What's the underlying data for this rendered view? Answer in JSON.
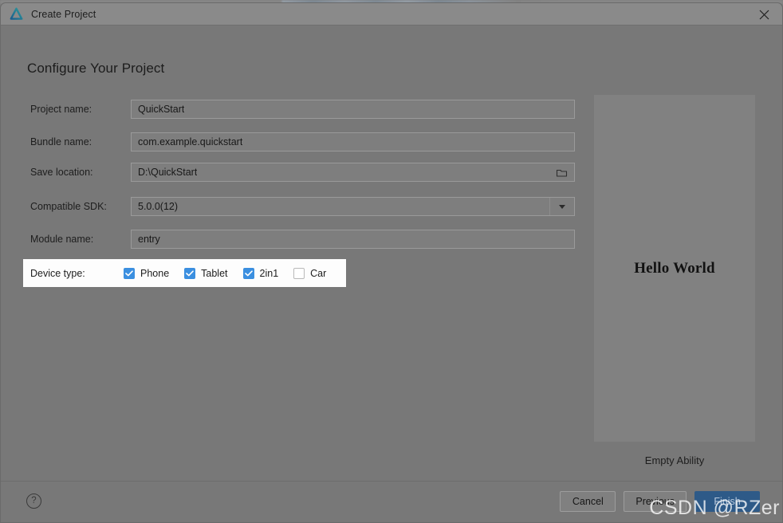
{
  "window": {
    "title": "Create Project",
    "logo_icon": "deveco-triangle-logo",
    "close_icon": "close-icon"
  },
  "page": {
    "heading": "Configure Your Project"
  },
  "form": {
    "fields": [
      {
        "label": "Project name:",
        "value": "QuickStart"
      },
      {
        "label": "Bundle name:",
        "value": "com.example.quickstart"
      },
      {
        "label": "Save location:",
        "value": "D:\\QuickStart",
        "trailing_icon": "folder-browse-icon"
      },
      {
        "label": "Compatible SDK:",
        "value": "5.0.0(12)",
        "trailing_icon": "chevron-down-icon"
      },
      {
        "label": "Module name:",
        "value": "entry"
      }
    ],
    "device_type": {
      "label": "Device type:",
      "options": [
        {
          "label": "Phone",
          "checked": true
        },
        {
          "label": "Tablet",
          "checked": true
        },
        {
          "label": "2in1",
          "checked": true
        },
        {
          "label": "Car",
          "checked": false
        }
      ]
    }
  },
  "preview": {
    "hello_text": "Hello World",
    "caption": "Empty Ability"
  },
  "footer": {
    "help_icon": "question-mark-icon",
    "help_label": "?",
    "buttons": [
      {
        "label": "Cancel",
        "style": "default"
      },
      {
        "label": "Previous",
        "style": "default"
      },
      {
        "label": "Finish",
        "style": "primary"
      }
    ]
  },
  "watermark": {
    "text": "CSDN @RZer"
  },
  "colors": {
    "dialog_background": "#787878",
    "titlebar": "#8a8a8a",
    "checkbox_checked": "#3b8fe0",
    "primary_button": "#2e5a88",
    "highlight_row": "#fdfdfd"
  }
}
